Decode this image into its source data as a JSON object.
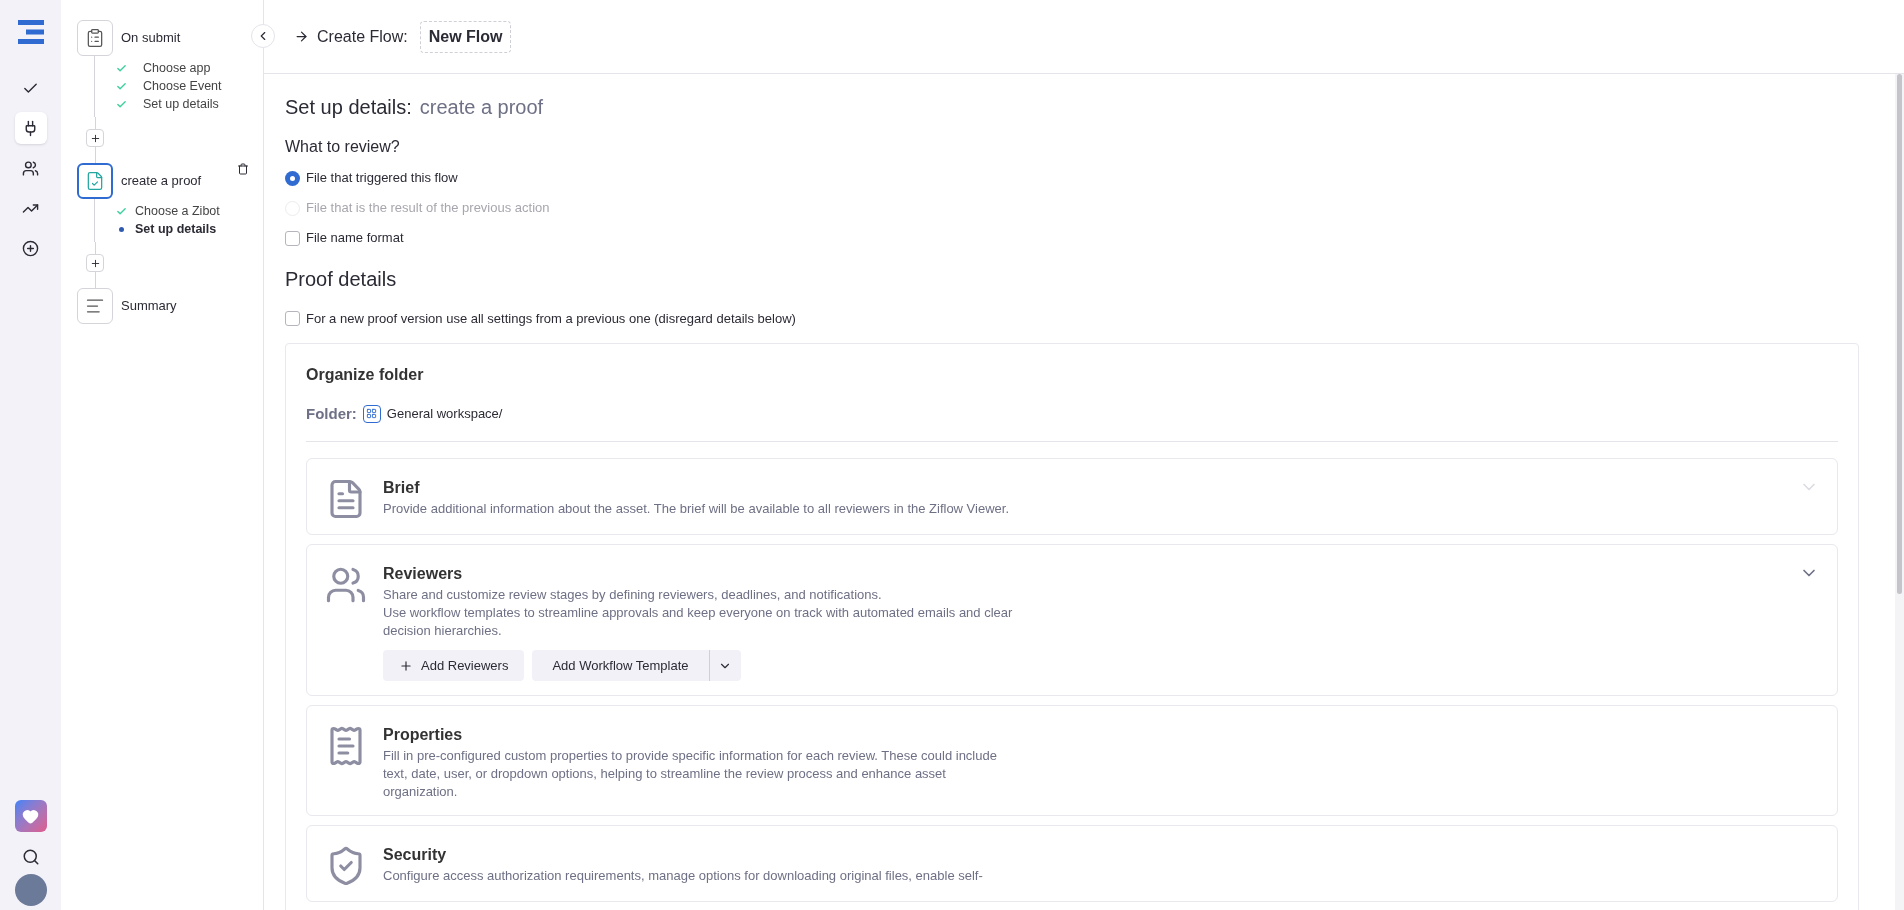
{
  "rail": {
    "items": [
      {
        "kind": "check",
        "selected": false
      },
      {
        "kind": "plug",
        "selected": true
      },
      {
        "kind": "users",
        "selected": false
      },
      {
        "kind": "trend",
        "selected": false
      },
      {
        "kind": "plus",
        "selected": false
      }
    ]
  },
  "steps": [
    {
      "kind": "trigger",
      "title": "On submit",
      "selected": false,
      "deletable": false,
      "substeps": [
        {
          "label": "Choose app",
          "done": true,
          "selected": false
        },
        {
          "label": "Choose Event",
          "done": true,
          "selected": false
        },
        {
          "label": "Set up details",
          "done": true,
          "selected": false
        }
      ]
    },
    {
      "kind": "action",
      "title": "create a proof",
      "selected": true,
      "deletable": true,
      "substeps": [
        {
          "label": "Choose a Zibot",
          "done": true,
          "selected": false
        },
        {
          "label": "Set up details",
          "done": false,
          "selected": true
        }
      ]
    },
    {
      "kind": "summary",
      "title": "Summary",
      "selected": false,
      "deletable": false
    }
  ],
  "header": {
    "prefix": "Create Flow:",
    "flow_name": "New Flow"
  },
  "title": {
    "main": "Set up details:",
    "sub": "create a proof"
  },
  "review": {
    "heading": "What to review?",
    "options": [
      {
        "kind": "radio",
        "label": "File that triggered this flow",
        "selected": true,
        "disabled": false
      },
      {
        "kind": "radio",
        "label": "File that is the result of the previous action",
        "selected": false,
        "disabled": true
      },
      {
        "kind": "checkbox",
        "label": "File name format",
        "checked": false
      }
    ]
  },
  "proof": {
    "heading": "Proof details",
    "reuse": {
      "label": "For a new proof version use all settings from a previous one (disregard details below)",
      "checked": false
    }
  },
  "folder": {
    "heading": "Organize folder",
    "label": "Folder:",
    "value": "General workspace/"
  },
  "sections": [
    {
      "kind": "brief",
      "title": "Brief",
      "description": "Provide additional information about the asset. The brief will be available to all reviewers in the Ziflow Viewer.",
      "toggle": {
        "disabled": true
      }
    },
    {
      "kind": "reviewers",
      "title": "Reviewers",
      "description": "Share and customize review stages by defining reviewers, deadlines, and notifications.\nUse workflow templates to streamline approvals and keep everyone on track with automated emails and clear decision hierarchies.",
      "toggle": {
        "disabled": false
      },
      "buttons": [
        {
          "kind": "add",
          "label": "Add Reviewers"
        },
        {
          "kind": "split",
          "label": "Add Workflow Template"
        }
      ]
    },
    {
      "kind": "properties",
      "title": "Properties",
      "description": "Fill in pre-configured custom properties to provide specific information for each review. These could include text, date, user, or dropdown options, helping to streamline the review process and enhance asset organization."
    },
    {
      "kind": "security",
      "title": "Security",
      "description": "Configure access authorization requirements, manage options for downloading original files, enable self-"
    }
  ]
}
